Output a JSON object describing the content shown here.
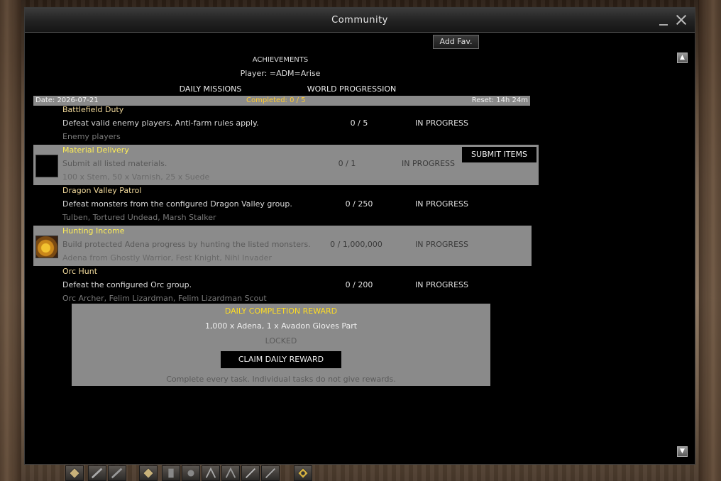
{
  "window": {
    "title": "Community",
    "add_fav_label": "Add Fav.",
    "scroll_up_glyph": "▲",
    "scroll_down_glyph": "▼"
  },
  "header": {
    "section_title": "ACHIEVEMENTS",
    "player_label": "Player: =ADM=Arise"
  },
  "tabs": [
    {
      "label": "DAILY MISSIONS",
      "active": true
    },
    {
      "label": "WORLD PROGRESSION",
      "active": false
    }
  ],
  "summary": {
    "date": "Date: 2026-07-21",
    "completed": "Completed: 0 / 5",
    "reset": "Reset: 14h 24m"
  },
  "tasks": [
    {
      "title": "Battlefield Duty",
      "description": "Defeat valid enemy players. Anti-farm rules apply.",
      "targets": "Enemy players",
      "progress": "0 / 5",
      "status": "IN PROGRESS",
      "highlighted": false,
      "icon": "none"
    },
    {
      "title": "Material Delivery",
      "description": "Submit all listed materials.",
      "targets": "100 x Stem, 50 x Varnish, 25 x Suede",
      "progress": "0 / 1",
      "status": "IN PROGRESS",
      "highlighted": true,
      "icon": "empty-item-slot",
      "action_label": "SUBMIT ITEMS"
    },
    {
      "title": "Dragon Valley Patrol",
      "description": "Defeat monsters from the configured Dragon Valley group.",
      "targets": "Tulben, Tortured Undead, Marsh Stalker",
      "progress": "0 / 250",
      "status": "IN PROGRESS",
      "highlighted": false,
      "icon": "none"
    },
    {
      "title": "Hunting Income",
      "description": "Build protected Adena progress by hunting the listed monsters.",
      "targets": "Adena from Ghostly Warrior, Fest Knight, Nihl Invader",
      "progress": "0 / 1,000,000",
      "status": "IN PROGRESS",
      "highlighted": true,
      "icon": "adena-gold-icon"
    },
    {
      "title": "Orc Hunt",
      "description": "Defeat the configured Orc group.",
      "targets": "Orc Archer, Felim Lizardman, Felim Lizardman Scout",
      "progress": "0 / 200",
      "status": "IN PROGRESS",
      "highlighted": false,
      "icon": "none"
    }
  ],
  "reward": {
    "title": "DAILY COMPLETION REWARD",
    "items": "1,000 x Adena, 1 x Avadon Gloves Part",
    "state": "LOCKED",
    "claim_label": "CLAIM DAILY REWARD",
    "note": "Complete every task. Individual tasks do not give rewards."
  },
  "shortcuts": [
    "diamond-icon",
    "sword-icon",
    "sword-icon",
    "diamond-icon",
    "potion-icon",
    "potion-icon",
    "claw-icon",
    "claw-icon",
    "staff-icon",
    "staff-icon",
    "gear-diamond-icon"
  ]
}
